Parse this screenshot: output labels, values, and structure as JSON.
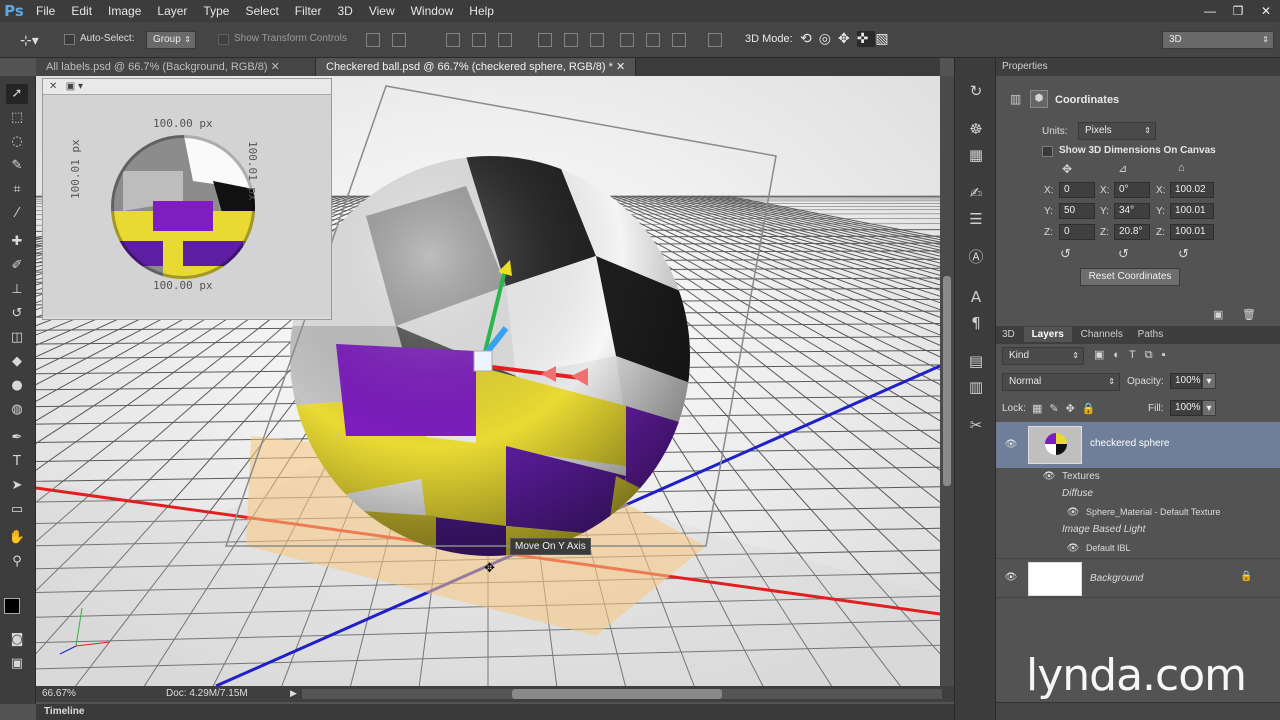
{
  "app": {
    "logo": "Ps"
  },
  "menu": [
    "File",
    "Edit",
    "Image",
    "Layer",
    "Type",
    "Select",
    "Filter",
    "3D",
    "View",
    "Window",
    "Help"
  ],
  "options": {
    "auto_select_label": "Auto-Select:",
    "auto_select_value": "Group",
    "show_transform": "Show Transform Controls",
    "mode_label": "3D Mode:",
    "workspace": "3D"
  },
  "tabs": [
    {
      "label": "All labels.psd @ 66.7% (Background, RGB/8)"
    },
    {
      "label": "Checkered ball.psd @ 66.7% (checkered sphere, RGB/8) *"
    }
  ],
  "preview": {
    "top": "100.00 px",
    "bottom": "100.00 px",
    "left": "100.01 px",
    "right": "100.01 px"
  },
  "canvas": {
    "tooltip": "Move On Y Axis"
  },
  "status": {
    "zoom": "66.67%",
    "doc": "Doc: 4.29M/7.15M"
  },
  "timeline": {
    "label": "Timeline"
  },
  "properties": {
    "title": "Properties",
    "section": "Coordinates",
    "units_label": "Units:",
    "units_value": "Pixels",
    "show_dims": "Show 3D Dimensions On Canvas",
    "axis_x": "X:",
    "axis_y": "Y:",
    "axis_z": "Z:",
    "pos": {
      "x": "0",
      "y": "50",
      "z": "0"
    },
    "rot": {
      "x": "0°",
      "y": "34°",
      "z": "20.8°"
    },
    "scale": {
      "x": "100.02",
      "y": "100.01",
      "z": "100.01"
    },
    "reset": "Reset Coordinates"
  },
  "layers": {
    "tabs": [
      "3D",
      "Layers",
      "Channels",
      "Paths"
    ],
    "kind": "Kind",
    "blend": "Normal",
    "opacity_label": "Opacity:",
    "opacity": "100%",
    "lock_label": "Lock:",
    "fill_label": "Fill:",
    "fill": "100%",
    "items": {
      "sphere": "checkered sphere",
      "textures": "Textures",
      "diffuse": "Diffuse",
      "material": "Sphere_Material - Default Texture",
      "ibl": "Image Based Light",
      "default_ibl": "Default IBL",
      "background": "Background"
    }
  },
  "watermark": "lynda.com"
}
